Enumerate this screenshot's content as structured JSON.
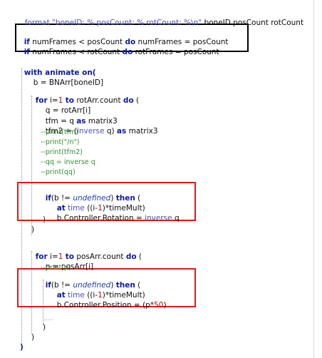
{
  "code": {
    "format_line": {
      "fn": "format",
      "str": "\"boneID: % posCount: % rotCount: %\\n\"",
      "args": " boneID posCount rotCount"
    },
    "if1": {
      "k1": "if",
      "a": " numFrames < posCount ",
      "k2": "do",
      "b": " numFrames = posCount"
    },
    "if2": {
      "k1": "if",
      "a": " numFrames < rotCount ",
      "k2": "do",
      "b": " rotFrames = posCount"
    },
    "with_line": {
      "k": "with animate on("
    },
    "b_assign": "b = BNArr[boneID]",
    "for1": {
      "k1": "for",
      "a": " i=",
      "n1": "1",
      "sp": " ",
      "k2": "to",
      "b": " rotArr.count ",
      "k3": "do",
      "c": " ("
    },
    "q_assign": "q = rotArr[i]",
    "tfm": {
      "a": "tfm = q ",
      "k": "as",
      "b": " matrix3"
    },
    "tfm2": {
      "a": "tfm2 = (",
      "fn": "inverse",
      "b": " q) ",
      "k": "as",
      "c": " matrix3"
    },
    "comments1": [
      "--print(tfm)",
      "--print(\"/n\")",
      "--print(tfm2)",
      "--qq = inverse q",
      "--print(qq)"
    ],
    "if_rot": {
      "k1": "if",
      "a": "(b != ",
      "u": "undefined",
      "b": ") ",
      "k2": "then",
      "c": " ("
    },
    "at_rot": {
      "k": "at",
      "fn": " time",
      "a": " ((i-",
      "n": "1",
      "b": ")*timeMult)"
    },
    "rot_assign": {
      "a": "b.Controller.Rotation = ",
      "fn": "inverse",
      "b": " q"
    },
    "close_paren": ")",
    "for2": {
      "k1": "for",
      "a": " i=",
      "n1": "1",
      "sp": " ",
      "k2": "to",
      "b": " posArr.count ",
      "k3": "do",
      "c": " ("
    },
    "p_assign": "p = posArr[i]",
    "comment2": "--print(p)",
    "if_pos": {
      "k1": "if",
      "a": "(b != ",
      "u": "undefined",
      "b": ") ",
      "k2": "then",
      "c": " ("
    },
    "at_pos": {
      "k": "at",
      "fn": " time",
      "a": " ((i-",
      "n": "1",
      "b": ")*timeMult)"
    },
    "pos_assign": {
      "a": "b.Controller.Position = (p*",
      "n": "50",
      "b": ")"
    }
  },
  "colors": {
    "keyword": "#0b18a8",
    "function": "#4a4fb5",
    "comment": "#2f8f2f",
    "number": "#b01010",
    "highlight_black": "#000000",
    "highlight_red": "#dd1a1a"
  }
}
